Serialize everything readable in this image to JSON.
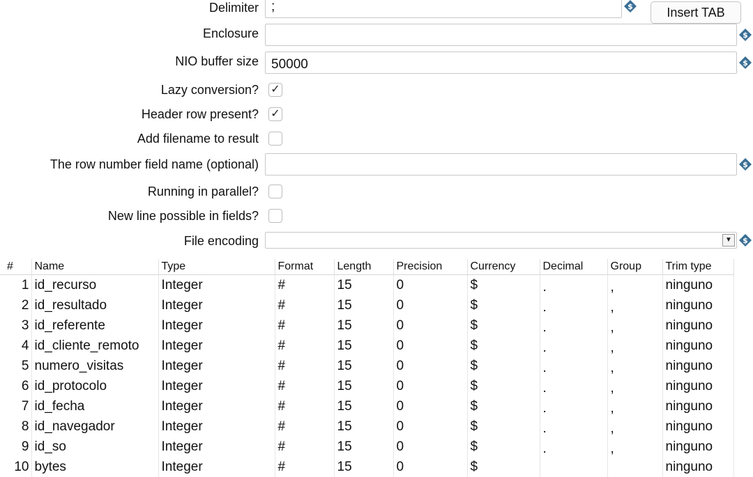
{
  "form": {
    "delimiter": {
      "label": "Delimiter",
      "value": ";"
    },
    "enclosure": {
      "label": "Enclosure",
      "value": ""
    },
    "nio_buffer": {
      "label": "NIO buffer size",
      "value": "50000"
    },
    "lazy_conversion": {
      "label": "Lazy conversion?",
      "checked": true,
      "mark": "✓"
    },
    "header_row": {
      "label": "Header row present?",
      "checked": true,
      "mark": "✓"
    },
    "add_filename": {
      "label": "Add filename to result",
      "checked": false
    },
    "row_number_field": {
      "label": "The row number field name (optional)",
      "value": ""
    },
    "running_parallel": {
      "label": "Running in parallel?",
      "checked": false
    },
    "new_line_possible": {
      "label": "New line possible in fields?",
      "checked": false
    },
    "file_encoding": {
      "label": "File encoding",
      "value": ""
    },
    "insert_tab_button": "Insert TAB"
  },
  "icons": {
    "variable": "dollar-variable-icon",
    "dropdown": "dropdown-arrow-icon"
  },
  "colors": {
    "variable_icon": "#3a6f95"
  },
  "table": {
    "columns": [
      "#",
      "Name",
      "Type",
      "Format",
      "Length",
      "Precision",
      "Currency",
      "Decimal",
      "Group",
      "Trim type"
    ],
    "rows": [
      [
        "1",
        "id_recurso",
        "Integer",
        "#",
        "15",
        "0",
        "$",
        ".",
        ",",
        "ninguno"
      ],
      [
        "2",
        "id_resultado",
        "Integer",
        "#",
        "15",
        "0",
        "$",
        ".",
        ",",
        "ninguno"
      ],
      [
        "3",
        "id_referente",
        "Integer",
        "#",
        "15",
        "0",
        "$",
        ".",
        ",",
        "ninguno"
      ],
      [
        "4",
        "id_cliente_remoto",
        "Integer",
        "#",
        "15",
        "0",
        "$",
        ".",
        ",",
        "ninguno"
      ],
      [
        "5",
        "numero_visitas",
        "Integer",
        "#",
        "15",
        "0",
        "$",
        ".",
        ",",
        "ninguno"
      ],
      [
        "6",
        "id_protocolo",
        "Integer",
        "#",
        "15",
        "0",
        "$",
        ".",
        ",",
        "ninguno"
      ],
      [
        "7",
        "id_fecha",
        "Integer",
        "#",
        "15",
        "0",
        "$",
        ".",
        ",",
        "ninguno"
      ],
      [
        "8",
        "id_navegador",
        "Integer",
        "#",
        "15",
        "0",
        "$",
        ".",
        ",",
        "ninguno"
      ],
      [
        "9",
        "id_so",
        "Integer",
        "#",
        "15",
        "0",
        "$",
        ".",
        ",",
        "ninguno"
      ],
      [
        "10",
        "bytes",
        "Integer",
        "#",
        "15",
        "0",
        "$",
        "",
        "",
        "ninguno"
      ]
    ]
  }
}
